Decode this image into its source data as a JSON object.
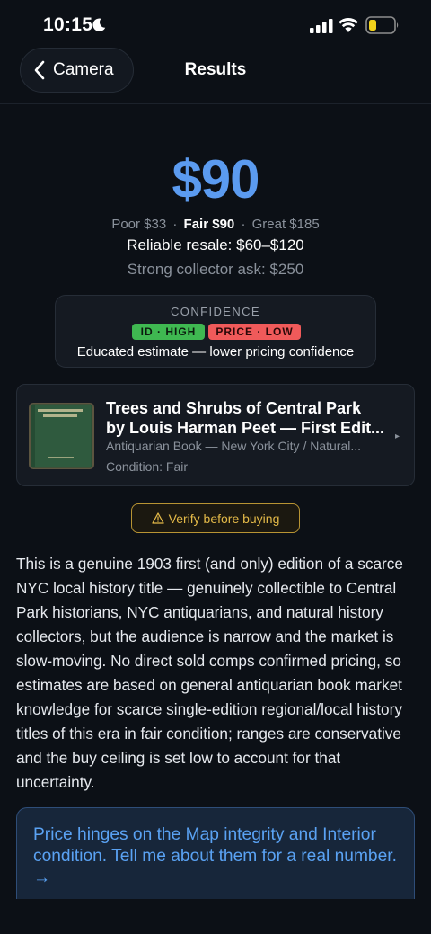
{
  "status_bar": {
    "time": "10:15",
    "icons": [
      "moon-icon",
      "signal-icon",
      "wifi-icon",
      "battery-icon"
    ],
    "battery_color": "#f2d21b"
  },
  "nav": {
    "back_label": "Camera",
    "title": "Results"
  },
  "pricing": {
    "main": "$90",
    "poor": "Poor $33",
    "fair": "Fair $90",
    "great": "Great $185",
    "separator": "·",
    "reliable_resale": "Reliable resale: $60–$120",
    "collector_ask": "Strong collector ask: $250",
    "accent_color": "#5b9bf0"
  },
  "confidence": {
    "label": "CONFIDENCE",
    "id_badge": "ID · HIGH",
    "price_badge": "PRICE · LOW",
    "summary": "Educated estimate — lower pricing confidence",
    "id_color": "#3fb851",
    "price_color": "#f05a5a"
  },
  "item": {
    "title_line1": "Trees and Shrubs of Central Park",
    "title_line2": "by Louis Harman Peet — First Edit...",
    "category": "Antiquarian Book — New York City / Natural...",
    "condition": "Condition: Fair",
    "thumbnail": "book-cover-thumbnail"
  },
  "verify": {
    "icon": "warning-icon",
    "label": "Verify before buying",
    "color": "#e3b948"
  },
  "description": "This is a genuine 1903 first (and only) edition of a scarce NYC local history title — genuinely collectible to Central Park historians, NYC antiquarians, and natural history collectors, but the audience is narrow and the market is slow-moving. No direct sold comps confirmed pricing, so estimates are based on general antiquarian book market knowledge for scarce single-edition regional/local history titles of this era in fair condition; ranges are conservative and the buy ceiling is set low to account for that uncertainty.",
  "prompt": {
    "text": "Price hinges on the Map integrity and Interior condition. Tell me about them for a real number. →",
    "color": "#5aa2f3"
  }
}
